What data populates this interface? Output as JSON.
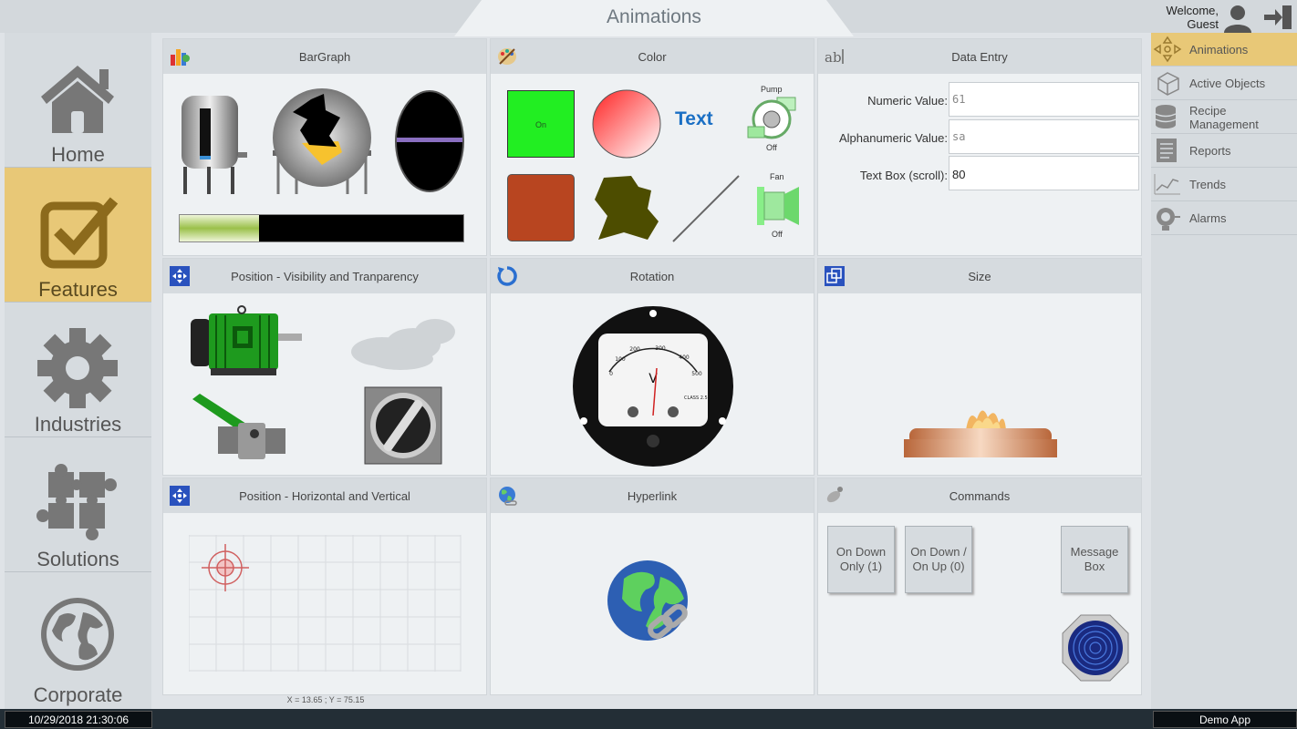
{
  "header": {
    "title": "Animations",
    "welcome": "Welcome,",
    "user": "Guest"
  },
  "left_nav": [
    {
      "id": "home",
      "label": "Home",
      "icon": "home-icon"
    },
    {
      "id": "features",
      "label": "Features",
      "icon": "checkbox-icon",
      "active": true
    },
    {
      "id": "industries",
      "label": "Industries",
      "icon": "gear-icon"
    },
    {
      "id": "solutions",
      "label": "Solutions",
      "icon": "puzzle-icon"
    },
    {
      "id": "corporate",
      "label": "Corporate",
      "icon": "globe-icon"
    }
  ],
  "right_nav": [
    {
      "id": "animations",
      "label": "Animations",
      "icon": "animations-icon",
      "active": true
    },
    {
      "id": "active-objects",
      "label": "Active Objects",
      "icon": "cube-icon"
    },
    {
      "id": "recipe",
      "label": "Recipe Management",
      "icon": "database-icon"
    },
    {
      "id": "reports",
      "label": "Reports",
      "icon": "report-icon"
    },
    {
      "id": "trends",
      "label": "Trends",
      "icon": "trend-icon"
    },
    {
      "id": "alarms",
      "label": "Alarms",
      "icon": "alarm-icon"
    }
  ],
  "panels": {
    "bargraph": {
      "title": "BarGraph",
      "level": 0.28
    },
    "color": {
      "title": "Color",
      "on_label": "On",
      "text_label": "Text",
      "pump_label": "Pump",
      "pump_state": "Off",
      "fan_label": "Fan",
      "fan_state": "Off"
    },
    "data_entry": {
      "title": "Data Entry",
      "numeric_label": "Numeric Value:",
      "numeric_value": "61",
      "alpha_label": "Alphanumeric Value:",
      "alpha_value": "sa",
      "textbox_label": "Text Box (scroll):",
      "textbox_value": "80"
    },
    "position_visibility": {
      "title": "Position - Visibility and Tranparency"
    },
    "rotation": {
      "title": "Rotation",
      "scale": [
        "0",
        "100",
        "200",
        "300",
        "400",
        "500"
      ],
      "unit": "V",
      "class": "CLASS 2.5"
    },
    "size": {
      "title": "Size"
    },
    "position_hv": {
      "title": "Position - Horizontal and Vertical",
      "coords": "X = 13.65 ; Y = 75.15"
    },
    "hyperlink": {
      "title": "Hyperlink"
    },
    "commands": {
      "title": "Commands",
      "btn1": "On Down Only (1)",
      "btn2": "On Down / On Up (0)",
      "btn3": "Message Box"
    }
  },
  "status": {
    "datetime": "10/29/2018 21:30:06",
    "app": "Demo App"
  },
  "colors": {
    "accent": "#e8c877",
    "status_bar": "#232e36",
    "text_blue": "#1a6fc4",
    "on_green": "#22ee22",
    "brick": "#b84520"
  }
}
